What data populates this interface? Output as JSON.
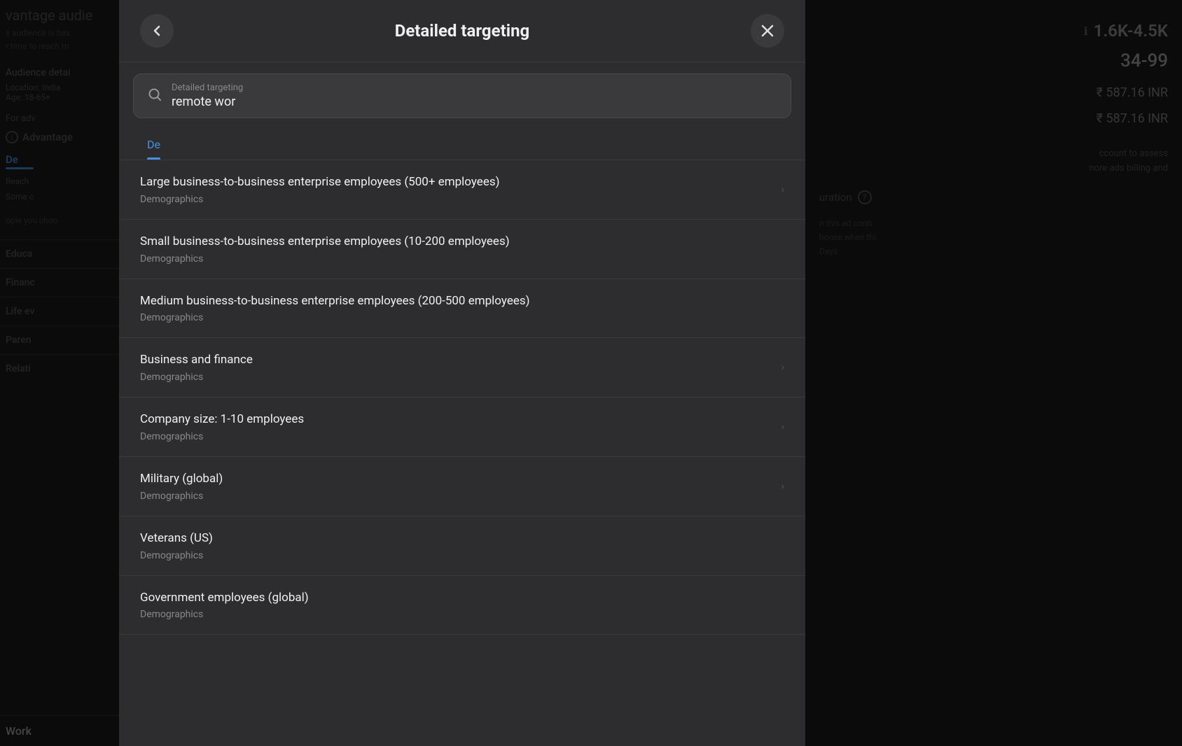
{
  "background": {
    "left": {
      "audience_title": "vantage audie",
      "audience_sub1": "s audience is bas",
      "audience_sub2": "r time to reach m",
      "advantage_label": "Advantage",
      "audience_details_title": "Audience detai",
      "location": "Location: India",
      "age": "Age: 18-65+",
      "for_adv": "For adv",
      "reach_label": "Reach",
      "some_label": "Some c",
      "people_label": "ople you choo",
      "sections": [
        {
          "label": "Educa"
        },
        {
          "label": "Financ"
        },
        {
          "label": "Life ev"
        },
        {
          "label": "Paren"
        },
        {
          "label": "Relati"
        },
        {
          "label": "Work"
        }
      ]
    },
    "right": {
      "reach_range": "1.6K-4.5K",
      "age_range": "34-99",
      "cost_1": "₹ 587.16 INR",
      "cost_2": "₹ 587.16 INR",
      "billing_text1": "ccount to assess",
      "billing_text2": "nore ads billing and",
      "duration_label": "uration",
      "duration_icon": "?"
    }
  },
  "modal": {
    "title": "Detailed targeting",
    "back_button_label": "←",
    "close_button_label": "×",
    "search": {
      "label": "Detailed targeting",
      "placeholder": "remote wor",
      "search_icon": "search"
    },
    "tabs": [
      {
        "label": "De",
        "active": true
      }
    ],
    "results": [
      {
        "name": "Large business-to-business enterprise employees (500+ employees)",
        "category": "Demographics",
        "has_arrow": true
      },
      {
        "name": "Small business-to-business enterprise employees (10-200 employees)",
        "category": "Demographics",
        "has_arrow": false
      },
      {
        "name": "Medium business-to-business enterprise employees (200-500 employees)",
        "category": "Demographics",
        "has_arrow": false
      },
      {
        "name": "Business and finance",
        "category": "Demographics",
        "has_arrow": true
      },
      {
        "name": "Company size: 1-10 employees",
        "category": "Demographics",
        "has_arrow": true
      },
      {
        "name": "Military (global)",
        "category": "Demographics",
        "has_arrow": true
      },
      {
        "name": "Veterans (US)",
        "category": "Demographics",
        "has_arrow": false
      },
      {
        "name": "Government employees (global)",
        "category": "Demographics",
        "has_arrow": false
      }
    ]
  },
  "colors": {
    "accent_blue": "#4a90d9",
    "modal_bg": "#2d2d2f",
    "item_bg": "#3a3a3c",
    "text_primary": "#f0f0f0",
    "text_secondary": "#888",
    "border": "#3a3a3c"
  }
}
